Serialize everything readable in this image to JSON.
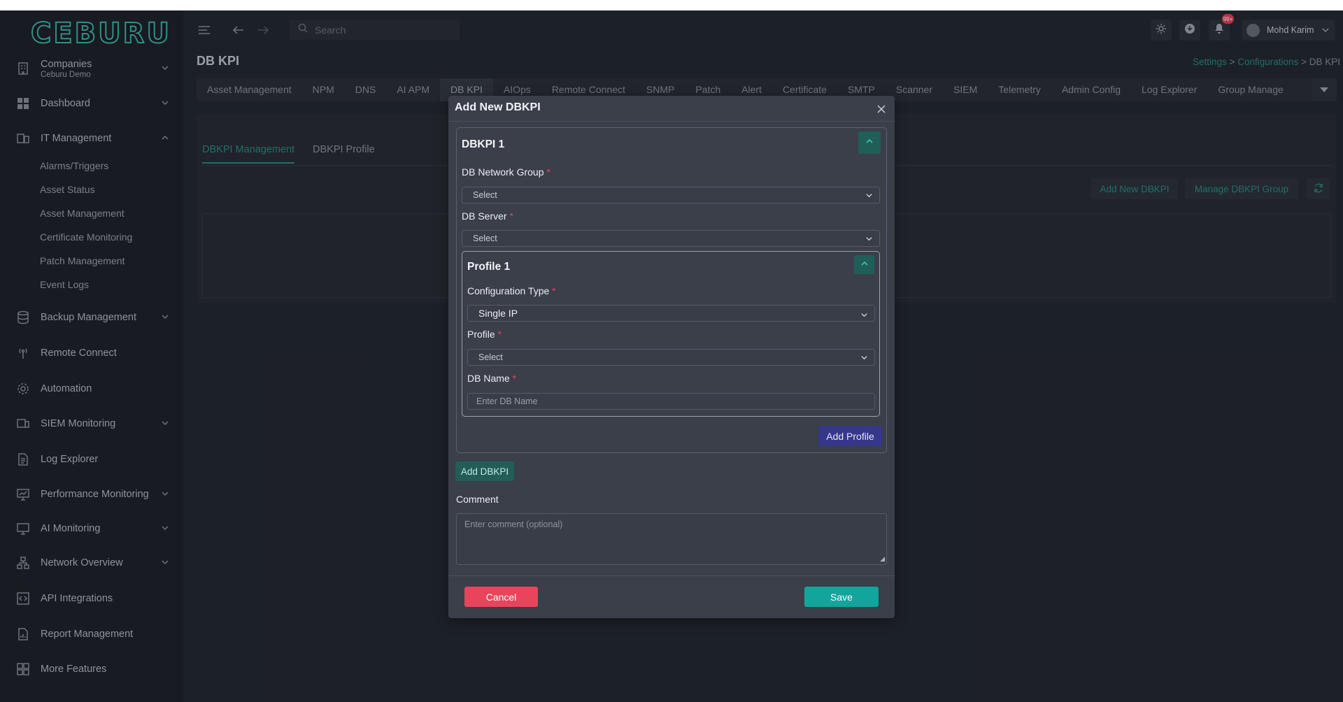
{
  "brand": {
    "logo_text": "CEBURU"
  },
  "header": {
    "search_placeholder": "Search",
    "notification_count": "99+",
    "user_name": "Mohd Karim"
  },
  "page": {
    "title": "DB KPI",
    "breadcrumb": {
      "settings": "Settings",
      "sep1": ">",
      "configurations": "Configurations",
      "sep2": ">",
      "current": "DB KPI"
    }
  },
  "sidebar": {
    "company": {
      "label": "Companies",
      "sub": "Ceburu Demo"
    },
    "items": [
      {
        "label": "Dashboard"
      },
      {
        "label": "IT Management"
      },
      {
        "label": "Backup Management"
      },
      {
        "label": "Remote Connect"
      },
      {
        "label": "Automation"
      },
      {
        "label": "SIEM Monitoring"
      },
      {
        "label": "Log Explorer"
      },
      {
        "label": "Performance Monitoring"
      },
      {
        "label": "AI Monitoring"
      },
      {
        "label": "Network Overview"
      },
      {
        "label": "API Integrations"
      },
      {
        "label": "Report Management"
      },
      {
        "label": "More Features"
      }
    ],
    "it_sub_items": [
      "Alarms/Triggers",
      "Asset Status",
      "Asset Management",
      "Certificate Monitoring",
      "Patch Management",
      "Event Logs"
    ]
  },
  "tabs": [
    "Asset Management",
    "NPM",
    "DNS",
    "AI APM",
    "DB KPI",
    "AIOps",
    "Remote Connect",
    "SNMP",
    "Patch",
    "Alert",
    "Certificate",
    "SMTP",
    "Scanner",
    "SIEM",
    "Telemetry",
    "Admin Config",
    "Log Explorer",
    "Group Manage"
  ],
  "active_tab": "DB KPI",
  "panel": {
    "subtabs": [
      "DBKPI Management",
      "DBKPI Profile"
    ],
    "add_button": "Add New DBKPI",
    "manage_button": "Manage DBKPI Group"
  },
  "modal": {
    "title": "Add New DBKPI",
    "dbkpi_title": "DBKPI 1",
    "network_group_label": "DB Network Group",
    "network_group_value": "Select",
    "server_label": "DB Server",
    "server_value": "Select",
    "profile_title": "Profile 1",
    "config_type_label": "Configuration Type",
    "config_type_value": "Single IP",
    "profile_label": "Profile",
    "profile_value": "Select",
    "db_name_label": "DB Name",
    "db_name_placeholder": "Enter DB Name",
    "required_mark": "*",
    "add_profile": "Add Profile",
    "add_dbkpi": "Add DBKPI",
    "comment_label": "Comment",
    "comment_placeholder": "Enter comment (optional)",
    "cancel": "Cancel",
    "save": "Save"
  },
  "colors": {
    "accent": "#2d8d86",
    "danger": "#e8455c",
    "save": "#12a59c",
    "add_profile": "#35378a"
  }
}
